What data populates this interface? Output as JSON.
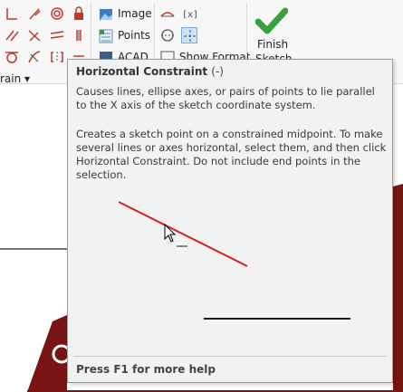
{
  "ribbon": {
    "image_label": "Image",
    "points_label": "Points",
    "acad_label": "ACAD",
    "show_format_label": "Show Format",
    "finish_label": "Finish",
    "finish_sub_label": "Sketch",
    "constrain_label": "rain ▾"
  },
  "tooltip": {
    "title": "Horizontal Constraint",
    "shortcut": "(-)",
    "paragraph1": "Causes lines, ellipse axes, or pairs of points to lie parallel to the X axis of the sketch coordinate system.",
    "paragraph2": "Creates a sketch point on a constrained midpoint. To make several lines or axes horizontal, select them, and then click Horizontal Constraint. Do not include end points in the selection.",
    "footer": "Press F1 for more help"
  },
  "colors": {
    "accent_selected": "#cfe3f7",
    "constraint_red": "#d42020",
    "finish_green": "#3aa13a",
    "tooltip_bg": "#f2f2f2",
    "model_red": "#7a1414"
  }
}
